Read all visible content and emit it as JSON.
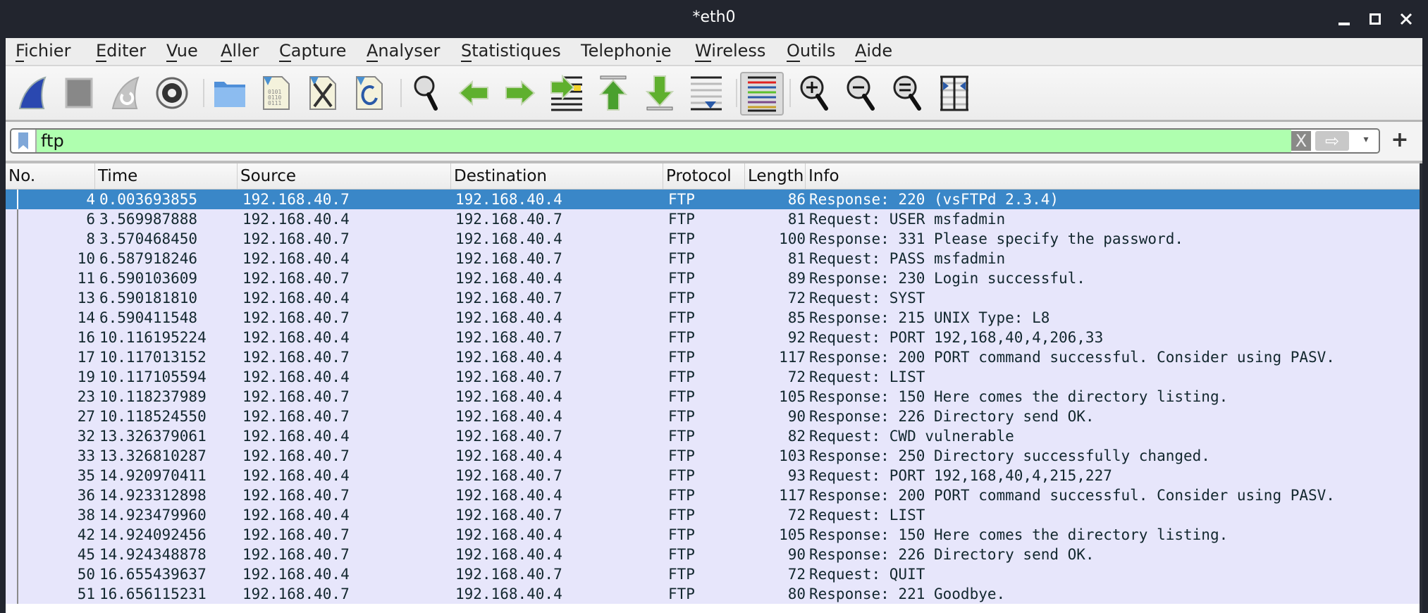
{
  "window": {
    "title": "*eth0",
    "controls": {
      "minimize": "minimize-icon",
      "maximize": "maximize-icon",
      "close": "close-icon"
    }
  },
  "menubar": {
    "items": [
      {
        "label": "Fichier",
        "mnemonic_index": 0
      },
      {
        "label": "Editer",
        "mnemonic_index": 0
      },
      {
        "label": "Vue",
        "mnemonic_index": 0
      },
      {
        "label": "Aller",
        "mnemonic_index": 0
      },
      {
        "label": "Capture",
        "mnemonic_index": 0
      },
      {
        "label": "Analyser",
        "mnemonic_index": 0
      },
      {
        "label": "Statistiques",
        "mnemonic_index": 0
      },
      {
        "label": "Telephonie",
        "mnemonic_index": 8
      },
      {
        "label": "Wireless",
        "mnemonic_index": 0
      },
      {
        "label": "Outils",
        "mnemonic_index": 0
      },
      {
        "label": "Aide",
        "mnemonic_index": 0
      }
    ]
  },
  "toolbar": {
    "buttons": [
      {
        "name": "start-capture-button",
        "icon": "shark-fin-icon"
      },
      {
        "name": "stop-capture-button",
        "icon": "stop-icon"
      },
      {
        "name": "restart-capture-button",
        "icon": "restart-fin-icon"
      },
      {
        "name": "capture-options-button",
        "icon": "gear-icon"
      },
      {
        "name": "open-file-button",
        "icon": "folder-icon"
      },
      {
        "name": "save-file-button",
        "icon": "binary-file-icon"
      },
      {
        "name": "close-file-button",
        "icon": "close-file-icon"
      },
      {
        "name": "reload-file-button",
        "icon": "reload-file-icon"
      },
      {
        "name": "find-packet-button",
        "icon": "magnifier-icon"
      },
      {
        "name": "go-back-button",
        "icon": "arrow-left-icon"
      },
      {
        "name": "go-forward-button",
        "icon": "arrow-right-icon"
      },
      {
        "name": "go-to-packet-button",
        "icon": "jump-to-packet-icon"
      },
      {
        "name": "first-packet-button",
        "icon": "arrow-up-top-icon"
      },
      {
        "name": "last-packet-button",
        "icon": "arrow-down-bottom-icon"
      },
      {
        "name": "autoscroll-button",
        "icon": "autoscroll-icon"
      },
      {
        "name": "colorize-button",
        "icon": "colorize-lines-icon",
        "active": true
      },
      {
        "name": "zoom-in-button",
        "icon": "zoom-in-icon"
      },
      {
        "name": "zoom-out-button",
        "icon": "zoom-out-icon"
      },
      {
        "name": "zoom-reset-button",
        "icon": "zoom-reset-icon"
      },
      {
        "name": "resize-columns-button",
        "icon": "resize-columns-icon"
      }
    ]
  },
  "filter": {
    "value": "ftp",
    "clear_label": "X",
    "apply_label": "⇨",
    "dropdown_label": "▾",
    "add_label": "+",
    "valid_color": "#afffaf"
  },
  "packet_list": {
    "columns": [
      "No.",
      "Time",
      "Source",
      "Destination",
      "Protocol",
      "Length",
      "Info"
    ],
    "selected_row_index": 0,
    "colors": {
      "row_bg": "#e7e6fb",
      "selected_bg": "#3a87c8"
    },
    "rows": [
      {
        "no": "4",
        "time": "0.003693855",
        "source": "192.168.40.7",
        "destination": "192.168.40.4",
        "protocol": "FTP",
        "length": "86",
        "info": "Response: 220 (vsFTPd 2.3.4)"
      },
      {
        "no": "6",
        "time": "3.569987888",
        "source": "192.168.40.4",
        "destination": "192.168.40.7",
        "protocol": "FTP",
        "length": "81",
        "info": "Request: USER msfadmin"
      },
      {
        "no": "8",
        "time": "3.570468450",
        "source": "192.168.40.7",
        "destination": "192.168.40.4",
        "protocol": "FTP",
        "length": "100",
        "info": "Response: 331 Please specify the password."
      },
      {
        "no": "10",
        "time": "6.587918246",
        "source": "192.168.40.4",
        "destination": "192.168.40.7",
        "protocol": "FTP",
        "length": "81",
        "info": "Request: PASS msfadmin"
      },
      {
        "no": "11",
        "time": "6.590103609",
        "source": "192.168.40.7",
        "destination": "192.168.40.4",
        "protocol": "FTP",
        "length": "89",
        "info": "Response: 230 Login successful."
      },
      {
        "no": "13",
        "time": "6.590181810",
        "source": "192.168.40.4",
        "destination": "192.168.40.7",
        "protocol": "FTP",
        "length": "72",
        "info": "Request: SYST"
      },
      {
        "no": "14",
        "time": "6.590411548",
        "source": "192.168.40.7",
        "destination": "192.168.40.4",
        "protocol": "FTP",
        "length": "85",
        "info": "Response: 215 UNIX Type: L8"
      },
      {
        "no": "16",
        "time": "10.116195224",
        "source": "192.168.40.4",
        "destination": "192.168.40.7",
        "protocol": "FTP",
        "length": "92",
        "info": "Request: PORT 192,168,40,4,206,33"
      },
      {
        "no": "17",
        "time": "10.117013152",
        "source": "192.168.40.7",
        "destination": "192.168.40.4",
        "protocol": "FTP",
        "length": "117",
        "info": "Response: 200 PORT command successful. Consider using PASV."
      },
      {
        "no": "19",
        "time": "10.117105594",
        "source": "192.168.40.4",
        "destination": "192.168.40.7",
        "protocol": "FTP",
        "length": "72",
        "info": "Request: LIST"
      },
      {
        "no": "23",
        "time": "10.118237989",
        "source": "192.168.40.7",
        "destination": "192.168.40.4",
        "protocol": "FTP",
        "length": "105",
        "info": "Response: 150 Here comes the directory listing."
      },
      {
        "no": "27",
        "time": "10.118524550",
        "source": "192.168.40.7",
        "destination": "192.168.40.4",
        "protocol": "FTP",
        "length": "90",
        "info": "Response: 226 Directory send OK."
      },
      {
        "no": "32",
        "time": "13.326379061",
        "source": "192.168.40.4",
        "destination": "192.168.40.7",
        "protocol": "FTP",
        "length": "82",
        "info": "Request: CWD vulnerable"
      },
      {
        "no": "33",
        "time": "13.326810287",
        "source": "192.168.40.7",
        "destination": "192.168.40.4",
        "protocol": "FTP",
        "length": "103",
        "info": "Response: 250 Directory successfully changed."
      },
      {
        "no": "35",
        "time": "14.920970411",
        "source": "192.168.40.4",
        "destination": "192.168.40.7",
        "protocol": "FTP",
        "length": "93",
        "info": "Request: PORT 192,168,40,4,215,227"
      },
      {
        "no": "36",
        "time": "14.923312898",
        "source": "192.168.40.7",
        "destination": "192.168.40.4",
        "protocol": "FTP",
        "length": "117",
        "info": "Response: 200 PORT command successful. Consider using PASV."
      },
      {
        "no": "38",
        "time": "14.923479960",
        "source": "192.168.40.4",
        "destination": "192.168.40.7",
        "protocol": "FTP",
        "length": "72",
        "info": "Request: LIST"
      },
      {
        "no": "42",
        "time": "14.924092456",
        "source": "192.168.40.7",
        "destination": "192.168.40.4",
        "protocol": "FTP",
        "length": "105",
        "info": "Response: 150 Here comes the directory listing."
      },
      {
        "no": "45",
        "time": "14.924348878",
        "source": "192.168.40.7",
        "destination": "192.168.40.4",
        "protocol": "FTP",
        "length": "90",
        "info": "Response: 226 Directory send OK."
      },
      {
        "no": "50",
        "time": "16.655439637",
        "source": "192.168.40.4",
        "destination": "192.168.40.7",
        "protocol": "FTP",
        "length": "72",
        "info": "Request: QUIT"
      },
      {
        "no": "51",
        "time": "16.656115231",
        "source": "192.168.40.7",
        "destination": "192.168.40.4",
        "protocol": "FTP",
        "length": "80",
        "info": "Response: 221 Goodbye."
      }
    ]
  }
}
